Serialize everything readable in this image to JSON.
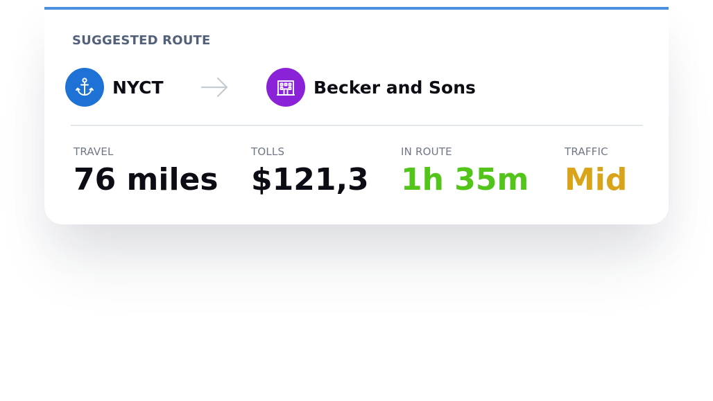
{
  "route": {
    "section_label": "SUGGESTED ROUTE",
    "accent_color": "#4a8fe0",
    "origin": {
      "name": "NYCT",
      "icon": "anchor-icon",
      "color": "#1e72d6"
    },
    "destination": {
      "name": "Becker and Sons",
      "icon": "building-icon",
      "color": "#8a23d8"
    },
    "arrow_icon": "arrow-right-icon"
  },
  "stats": {
    "travel": {
      "label": "TRAVEL",
      "value": "76 miles",
      "color": "#0c0c14"
    },
    "tolls": {
      "label": "TOLLS",
      "value": "$121,3",
      "color": "#0c0c14"
    },
    "in_route": {
      "label": "IN ROUTE",
      "value": "1h 35m",
      "color": "#52c41a"
    },
    "traffic": {
      "label": "TRAFFIC",
      "value": "Mid",
      "color": "#d9a31a"
    }
  }
}
